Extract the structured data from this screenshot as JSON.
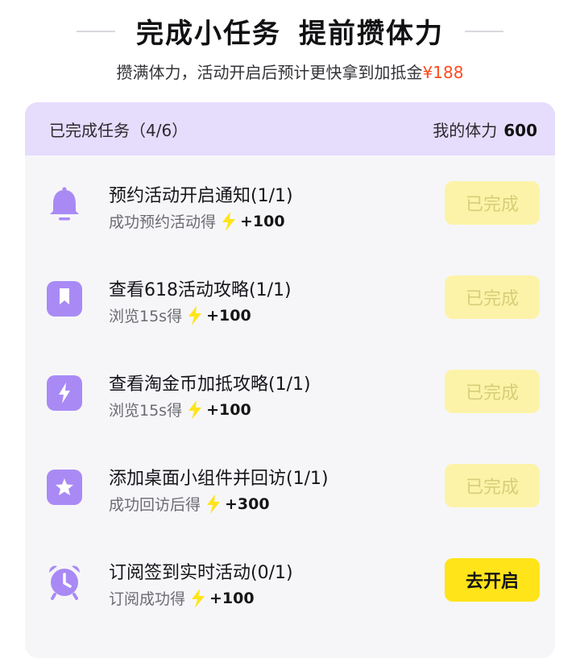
{
  "header": {
    "title_part1": "完成小任务",
    "title_part2": "提前攒体力",
    "subtitle_text": "攒满体力，活动开启后预计更快拿到加抵金",
    "subtitle_amount": "¥188"
  },
  "summary": {
    "progress_label": "已完成任务（4/6）",
    "stamina_label": "我的体力",
    "stamina_value": "600"
  },
  "colors": {
    "accent_purple": "#a98af5",
    "card_header_bg": "#e6dcfb",
    "bolt_yellow": "#ffe41a",
    "done_button_bg": "#fcf3a8",
    "go_button_bg": "#ffe41a",
    "amount_red": "#ff4b1f"
  },
  "tasks": [
    {
      "icon": "bell-icon",
      "name": "预约活动开启通知(1/1)",
      "desc": "成功预约活动得",
      "reward": "+100",
      "button": "已完成",
      "status": "done"
    },
    {
      "icon": "bookmark-icon",
      "name": "查看618活动攻略(1/1)",
      "desc": "浏览15s得",
      "reward": "+100",
      "button": "已完成",
      "status": "done"
    },
    {
      "icon": "lightning-icon",
      "name": "查看淘金币加抵攻略(1/1)",
      "desc": "浏览15s得",
      "reward": "+100",
      "button": "已完成",
      "status": "done"
    },
    {
      "icon": "star-icon",
      "name": "添加桌面小组件并回访(1/1)",
      "desc": "成功回访后得",
      "reward": "+300",
      "button": "已完成",
      "status": "done"
    },
    {
      "icon": "alarm-clock-icon",
      "name": "订阅签到实时活动(0/1)",
      "desc": "订阅成功得",
      "reward": "+100",
      "button": "去开启",
      "status": "todo"
    }
  ]
}
